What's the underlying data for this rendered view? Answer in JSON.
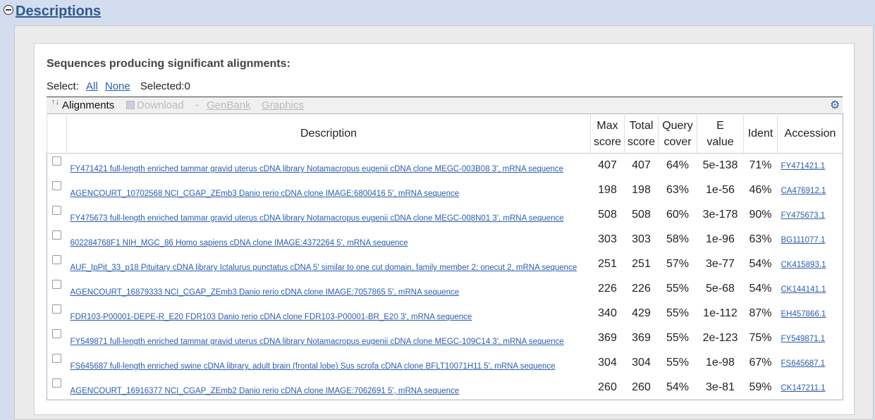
{
  "section": {
    "title": "Descriptions"
  },
  "heading": "Sequences producing significant alignments:",
  "select": {
    "label": "Select:",
    "all": "All",
    "none": "None",
    "selected": "Selected:0"
  },
  "toolbar": {
    "alignments": "Alignments",
    "download": "Download",
    "genbank": "GenBank",
    "graphics": "Graphics"
  },
  "columns": {
    "description": "Description",
    "max_score_1": "Max",
    "max_score_2": "score",
    "total_score_1": "Total",
    "total_score_2": "score",
    "query_cover_1": "Query",
    "query_cover_2": "cover",
    "evalue_1": "E",
    "evalue_2": "value",
    "ident": "Ident",
    "accession": "Accession"
  },
  "rows": [
    {
      "description": "FY471421 full-length enriched tammar gravid uterus cDNA library Notamacropus eugenii cDNA clone MEGC-003B08 3', mRNA sequence",
      "max_score": "407",
      "total_score": "407",
      "query_cover": "64%",
      "evalue": "5e-138",
      "ident": "71%",
      "accession": "FY471421.1"
    },
    {
      "description": "AGENCOURT_10702568 NCI_CGAP_ZEmb3 Danio rerio cDNA clone IMAGE:6800416 5', mRNA sequence",
      "max_score": "198",
      "total_score": "198",
      "query_cover": "63%",
      "evalue": "1e-56",
      "ident": "46%",
      "accession": "CA476912.1"
    },
    {
      "description": "FY475673 full-length enriched tammar gravid uterus cDNA library Notamacropus eugenii cDNA clone MEGC-008N01 3', mRNA sequence",
      "max_score": "508",
      "total_score": "508",
      "query_cover": "60%",
      "evalue": "3e-178",
      "ident": "90%",
      "accession": "FY475673.1"
    },
    {
      "description": "602284768F1 NIH_MGC_86 Homo sapiens cDNA clone IMAGE:4372264 5', mRNA sequence",
      "max_score": "303",
      "total_score": "303",
      "query_cover": "58%",
      "evalue": "1e-96",
      "ident": "63%",
      "accession": "BG111077.1"
    },
    {
      "description": "AUF_IpPit_33_p18 Pituitary cDNA library Ictalurus punctatus cDNA 5' similar to one cut domain, family member 2; onecut 2, mRNA sequence",
      "max_score": "251",
      "total_score": "251",
      "query_cover": "57%",
      "evalue": "3e-77",
      "ident": "54%",
      "accession": "CK415893.1"
    },
    {
      "description": "AGENCOURT_16879333 NCI_CGAP_ZEmb3 Danio rerio cDNA clone IMAGE:7057865 5', mRNA sequence",
      "max_score": "226",
      "total_score": "226",
      "query_cover": "55%",
      "evalue": "5e-68",
      "ident": "54%",
      "accession": "CK144141.1"
    },
    {
      "description": "FDR103-P00001-DEPE-R_E20 FDR103 Danio rerio cDNA clone FDR103-P00001-BR_E20 3', mRNA sequence",
      "max_score": "340",
      "total_score": "429",
      "query_cover": "55%",
      "evalue": "1e-112",
      "ident": "87%",
      "accession": "EH457866.1"
    },
    {
      "description": "FY549871 full-length enriched tammar gravid uterus cDNA library Notamacropus eugenii cDNA clone MEGC-109C14 3', mRNA sequence",
      "max_score": "369",
      "total_score": "369",
      "query_cover": "55%",
      "evalue": "2e-123",
      "ident": "75%",
      "accession": "FY549871.1"
    },
    {
      "description": "FS645687 full-length enriched swine cDNA library, adult brain (frontal lobe) Sus scrofa cDNA clone BFLT10071H11 5', mRNA sequence",
      "max_score": "304",
      "total_score": "304",
      "query_cover": "55%",
      "evalue": "1e-98",
      "ident": "67%",
      "accession": "FS645687.1"
    },
    {
      "description": "AGENCOURT_16916377 NCI_CGAP_ZEmb2 Danio rerio cDNA clone IMAGE:7062691 5', mRNA sequence",
      "max_score": "260",
      "total_score": "260",
      "query_cover": "54%",
      "evalue": "3e-81",
      "ident": "59%",
      "accession": "CK147211.1"
    }
  ]
}
